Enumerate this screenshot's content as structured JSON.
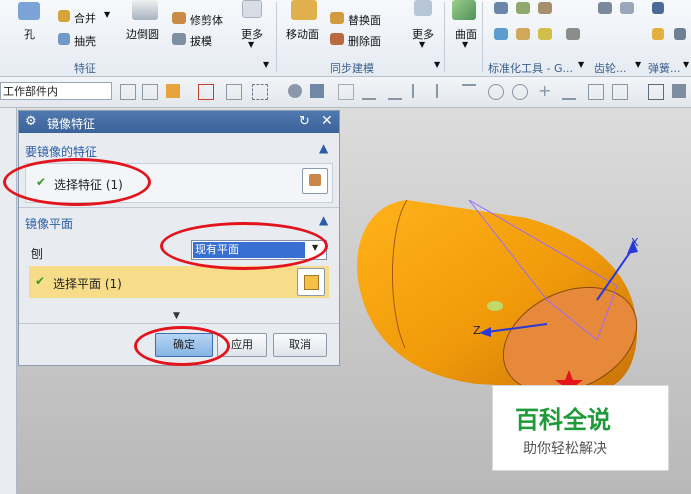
{
  "ribbon": {
    "hole": "孔",
    "merge": "合并",
    "shell": "抽壳",
    "edge_blend": "边倒圆",
    "trim_body": "修剪体",
    "draft": "拔模",
    "more1": "更多",
    "move_face": "移动面",
    "replace_face": "替换面",
    "delete_face": "删除面",
    "more2": "更多",
    "surface": "曲面",
    "more3": "更多",
    "group_feature": "特征",
    "group_sync": "同步建模",
    "group_std": "标准化工具 - G...",
    "group_gear": "齿轮...",
    "group_spring": "弹簧..."
  },
  "toolbar": {
    "filter_value": "工作部件内"
  },
  "dialog": {
    "title": "镜像特征",
    "section1_title": "要镜像的特征",
    "select_feature": "选择特征 (1)",
    "section2_title": "镜像平面",
    "plane_label": "刨",
    "plane_option": "现有平面",
    "select_plane": "选择平面 (1)",
    "ok": "确定",
    "apply": "应用",
    "cancel": "取消"
  },
  "axes": {
    "x": "X",
    "z": "Z"
  },
  "watermark": {
    "title": "百科全说",
    "subtitle": "助你轻松解决"
  }
}
